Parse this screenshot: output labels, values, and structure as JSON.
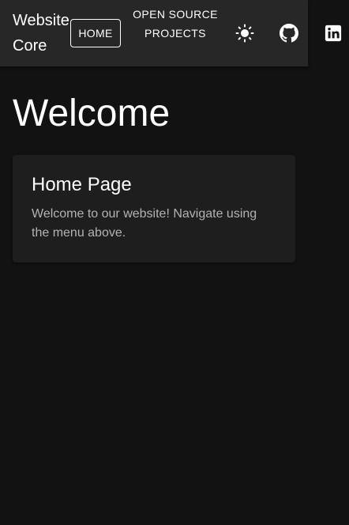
{
  "navbar": {
    "brand": "Website Core",
    "home_label": "HOME",
    "open_source_label": "OPEN SOURCE PROJECTS",
    "icons": [
      "sun-icon",
      "github-icon",
      "linkedin-icon"
    ]
  },
  "main": {
    "heading": "Welcome",
    "card": {
      "title": "Home Page",
      "body": "Welcome to our website! Navigate using the menu above."
    }
  },
  "colors": {
    "background": "#121212",
    "navbar": "#272727",
    "card": "#1e1e1e",
    "text": "#ffffff",
    "secondary_text": "#b3b3b3"
  }
}
